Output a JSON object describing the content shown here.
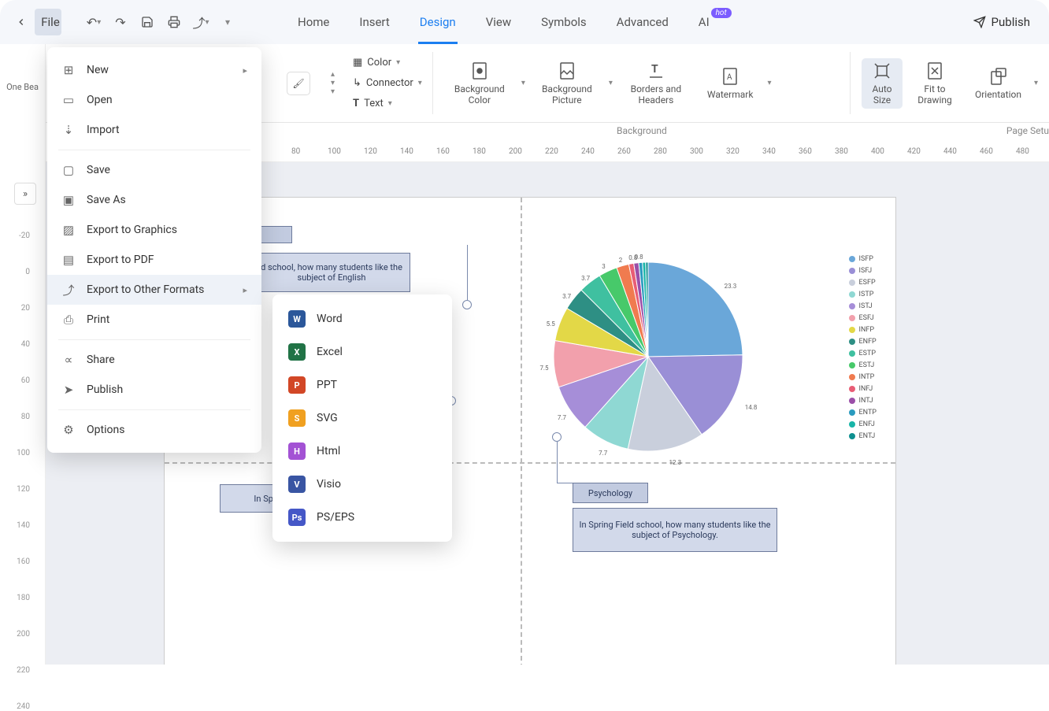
{
  "topbar": {
    "file_label": "File",
    "publish_label": "Publish"
  },
  "tabs": [
    "Home",
    "Insert",
    "Design",
    "View",
    "Symbols",
    "Advanced",
    "AI"
  ],
  "tabs_active": 2,
  "ai_badge": "hot",
  "ribbon": {
    "color": "Color",
    "connector": "Connector",
    "text": "Text",
    "bg_color": "Background Color",
    "bg_picture": "Background Picture",
    "borders": "Borders and Headers",
    "watermark": "Watermark",
    "auto_size": "Auto Size",
    "fit": "Fit to Drawing",
    "orientation": "Orientation",
    "group_bg": "Background",
    "group_pg": "Page Setu"
  },
  "left_snippet": "One\nBea",
  "h_ruler": [
    80,
    100,
    120,
    140,
    160,
    180,
    200,
    220,
    240,
    260,
    280,
    300,
    320,
    340,
    360,
    380,
    400,
    420,
    440,
    460,
    480
  ],
  "v_ruler": [
    -20,
    0,
    20,
    40,
    60,
    80,
    100,
    120,
    140,
    160,
    180,
    200,
    220,
    240
  ],
  "file_menu": {
    "new": "New",
    "open": "Open",
    "import_": "Import",
    "save": "Save",
    "save_as": "Save As",
    "exp_g": "Export to Graphics",
    "exp_pdf": "Export to PDF",
    "exp_other": "Export to Other Formats",
    "print": "Print",
    "share": "Share",
    "publish": "Publish",
    "options": "Options"
  },
  "export_formats": [
    {
      "label": "Word",
      "color": "#2b579a",
      "id": "W"
    },
    {
      "label": "Excel",
      "color": "#217346",
      "id": "X"
    },
    {
      "label": "PPT",
      "color": "#d24726",
      "id": "P"
    },
    {
      "label": "SVG",
      "color": "#f0a020",
      "id": "S"
    },
    {
      "label": "Html",
      "color": "#a352d4",
      "id": "H"
    },
    {
      "label": "Visio",
      "color": "#3955a3",
      "id": "V"
    },
    {
      "label": "PS/EPS",
      "color": "#4557c7",
      "id": "Ps"
    }
  ],
  "canvas": {
    "text1": "d school, how many students like the subject of English",
    "text2": "In Spring",
    "psych_label": "Psychology",
    "psych_desc": "In Spring Field school, how many students like the subject of Psychology."
  },
  "chart_data": {
    "type": "pie",
    "title": "",
    "series": [
      {
        "name": "ISFP",
        "value": 23.3,
        "color": "#6aa7d9"
      },
      {
        "name": "ISFJ",
        "value": 14.8,
        "color": "#9a8fd6"
      },
      {
        "name": "ESFP",
        "value": 12.3,
        "color": "#c9cfdc"
      },
      {
        "name": "ISTP",
        "value": 7.7,
        "color": "#8fd8d3"
      },
      {
        "name": "ISTJ",
        "value": 7.7,
        "color": "#a68ed8"
      },
      {
        "name": "ESFJ",
        "value": 7.5,
        "color": "#f2a0ac"
      },
      {
        "name": "INFP",
        "value": 5.5,
        "color": "#e3d847"
      },
      {
        "name": "ENFP",
        "value": 3.7,
        "color": "#2e8f84"
      },
      {
        "name": "ESTP",
        "value": 3.7,
        "color": "#3fc0a0"
      },
      {
        "name": "ESTJ",
        "value": 3.0,
        "color": "#47c96a"
      },
      {
        "name": "INTP",
        "value": 2.0,
        "color": "#f07b4f"
      },
      {
        "name": "INFJ",
        "value": 0.8,
        "color": "#e85d75"
      },
      {
        "name": "INTJ",
        "value": 0.8,
        "color": "#9b4fa8"
      },
      {
        "name": "ENTP",
        "value": 0.6,
        "color": "#2a9bbf"
      },
      {
        "name": "ENFJ",
        "value": 0.5,
        "color": "#18b5a8"
      },
      {
        "name": "ENTJ",
        "value": 0.4,
        "color": "#0e9090"
      }
    ]
  }
}
